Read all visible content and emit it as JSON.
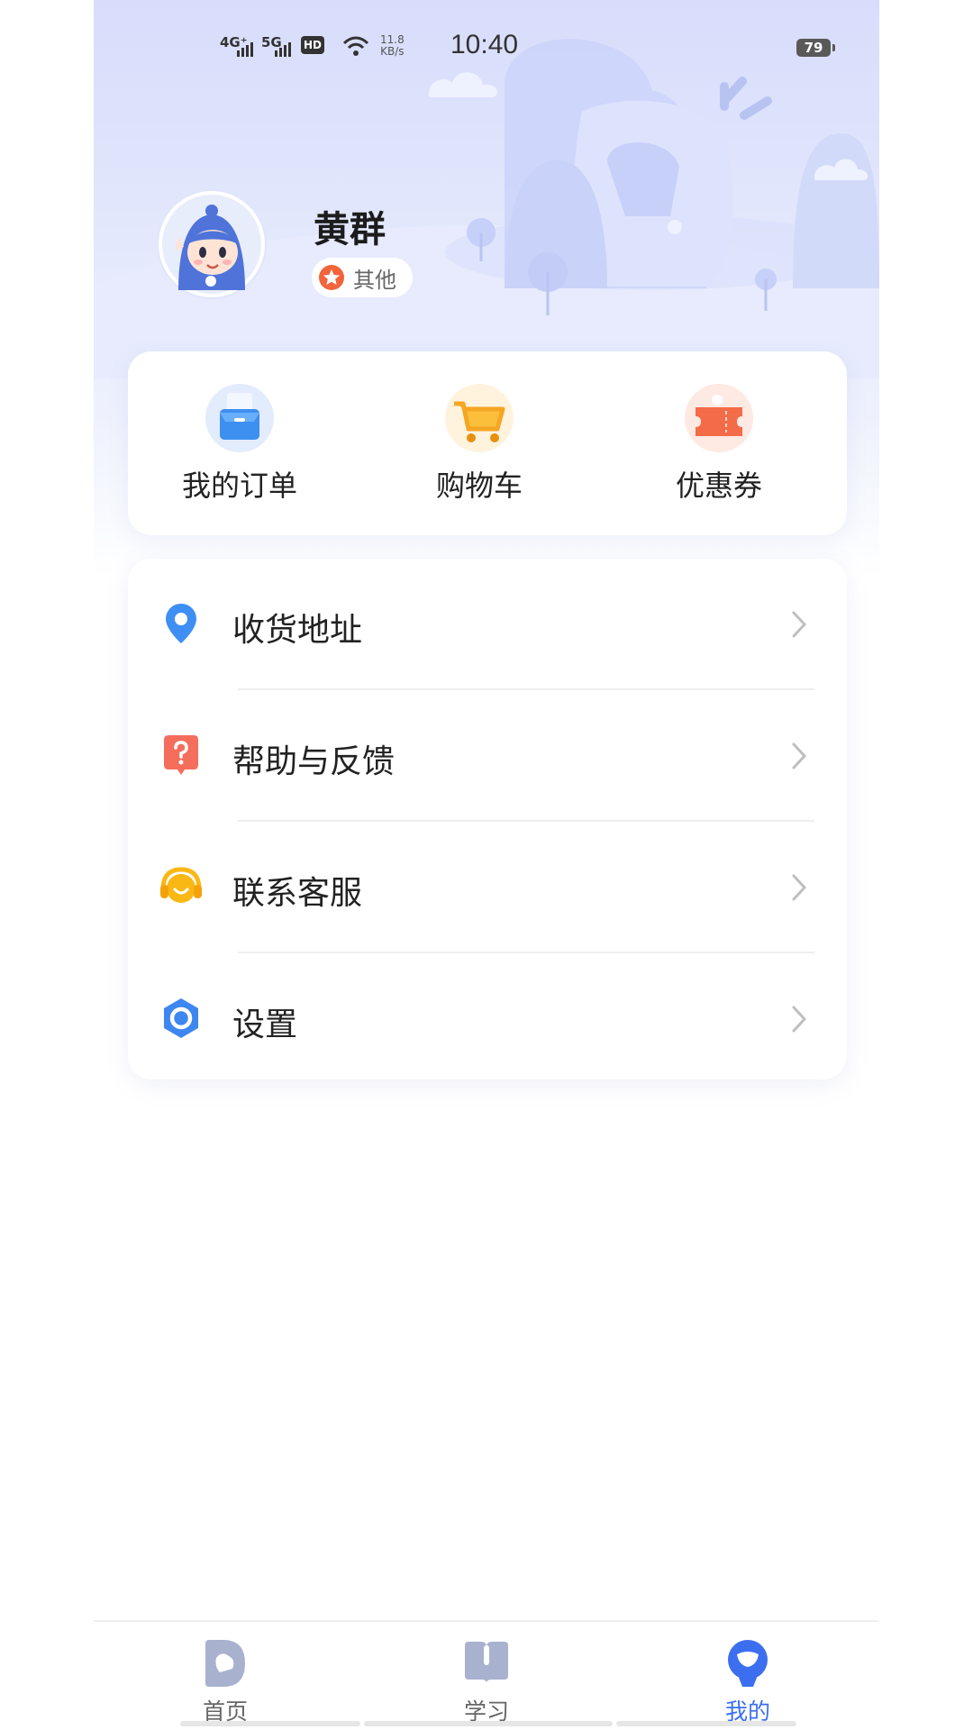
{
  "status_bar": {
    "network_1": "4G⁺",
    "network_2": "5G",
    "hd": "HD",
    "speed_value": "11.8",
    "speed_unit": "KB/s",
    "time": "10:40",
    "battery": "79"
  },
  "profile": {
    "name": "黄群",
    "tag": "其他"
  },
  "quick_actions": [
    {
      "label": "我的订单",
      "icon": "order-folder-icon"
    },
    {
      "label": "购物车",
      "icon": "shopping-cart-icon"
    },
    {
      "label": "优惠券",
      "icon": "coupon-ticket-icon"
    }
  ],
  "menu": [
    {
      "label": "收货地址",
      "icon": "location-pin-icon"
    },
    {
      "label": "帮助与反馈",
      "icon": "help-question-icon"
    },
    {
      "label": "联系客服",
      "icon": "headset-icon"
    },
    {
      "label": "设置",
      "icon": "settings-gear-icon"
    }
  ],
  "tabbar": {
    "items": [
      {
        "label": "首页",
        "icon": "home-icon",
        "active": false
      },
      {
        "label": "学习",
        "icon": "book-icon",
        "active": false
      },
      {
        "label": "我的",
        "icon": "profile-icon",
        "active": true
      }
    ]
  },
  "colors": {
    "accent": "#3c6ef0",
    "hero_bg": "#dde2fb",
    "text_primary": "#222222",
    "text_secondary": "#666666"
  }
}
